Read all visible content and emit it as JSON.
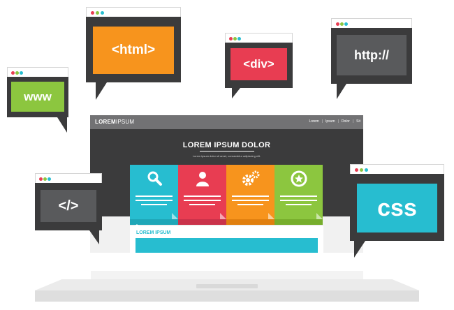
{
  "colors": {
    "red": "#e83d52",
    "orange": "#f7941d",
    "blue": "#27bdd0",
    "green": "#8cc63f",
    "dark": "#3b3b3c",
    "gray": "#595a5c"
  },
  "bubbles": {
    "html": {
      "label": "<html>"
    },
    "div": {
      "label": "<div>"
    },
    "http": {
      "label": "http://"
    },
    "www": {
      "label": "www"
    },
    "code": {
      "label": "</>"
    },
    "css": {
      "label": "css"
    }
  },
  "site": {
    "logo_bold": "LOREM",
    "logo_light": "IPSUM",
    "nav": [
      "Lorem",
      "Ipsum",
      "Dolor",
      "Sit"
    ],
    "hero_title": "LOREM IPSUM DOLOR",
    "hero_subtitle": "Lorem ipsum dolor sit amet, consectetur adipiscing elit.",
    "section_title": "LOREM IPSUM",
    "card_icons": [
      "search-icon",
      "user-icon",
      "gears-icon",
      "star-badge-icon"
    ]
  }
}
